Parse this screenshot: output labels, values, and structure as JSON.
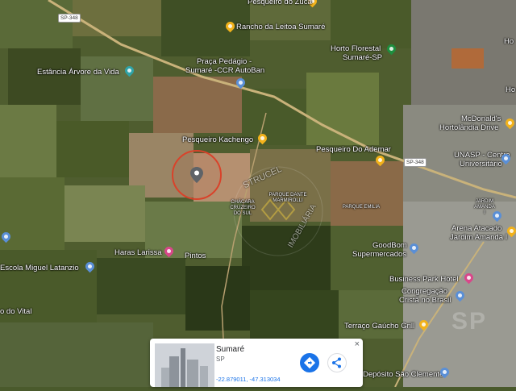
{
  "map": {
    "places": {
      "pesqueiro_zuca": "Pesqueiro do Zuca",
      "rancho_leitoa": "Rancho da Leitoa Sumaré",
      "horto_florestal_1": "Horto Florestal",
      "horto_florestal_2": "Sumaré-SP",
      "estancia_arvore": "Estância Árvore da Vida",
      "praca_pedagio_1": "Praça Pedágio -",
      "praca_pedagio_2": "Sumaré -CCR AutoBan",
      "mcdonalds_1": "McDonald's",
      "mcdonalds_2": "Hortolândia Drive",
      "pesqueiro_kachengo": "Pesqueiro Kachengo",
      "pesqueiro_ademar": "Pesqueiro Do Ademar",
      "unasp_1": "UNASP - Centro",
      "unasp_2": "Universitário",
      "jardim_amanda": "JARDIM AMANDA I",
      "chacara_cruzeiro": "CHÁCARA CRUZEIRO DO SUL",
      "parque_dante": "PARQUE DANTE MARMIROLLI",
      "parque_emilia": "PARQUE EMILIA",
      "haras_larissa": "Haras Larissa",
      "pintos": "Pintos",
      "goodbom_1": "GoodBom",
      "goodbom_2": "Supermercados",
      "arena_1": "Arena Atacado",
      "arena_2": "Jardim Amanda I",
      "escola": "Escola Miguel Latanzio",
      "business_park": "Business Park Hotel",
      "congregacao_1": "Congregação",
      "congregacao_2": "Cristã no Brasil",
      "vital": "o do Vital",
      "terraco": "Terraço Gaúcho Grill",
      "deposito": "Depósito São Clemente",
      "ho_right": "Ho",
      "hoc_right": "Ho"
    },
    "roads": {
      "sp348_a": "SP-348",
      "sp348_b": "SP-348"
    },
    "watermark": {
      "brand_1": "STRUCEL",
      "brand_2": "IMOBILIÁRIA",
      "corner": "SP"
    }
  },
  "card": {
    "title": "Sumaré",
    "subtitle": "SP",
    "coords": "-22.879011, -47.313034",
    "close": "×"
  },
  "colors": {
    "pin_yellow": "#f2b21b",
    "pin_green": "#1e8e3e",
    "pin_blue": "#5a8fd6",
    "pin_pink": "#d9478a",
    "accent_blue": "#1a73e8",
    "marker_circle": "#d9422a"
  }
}
